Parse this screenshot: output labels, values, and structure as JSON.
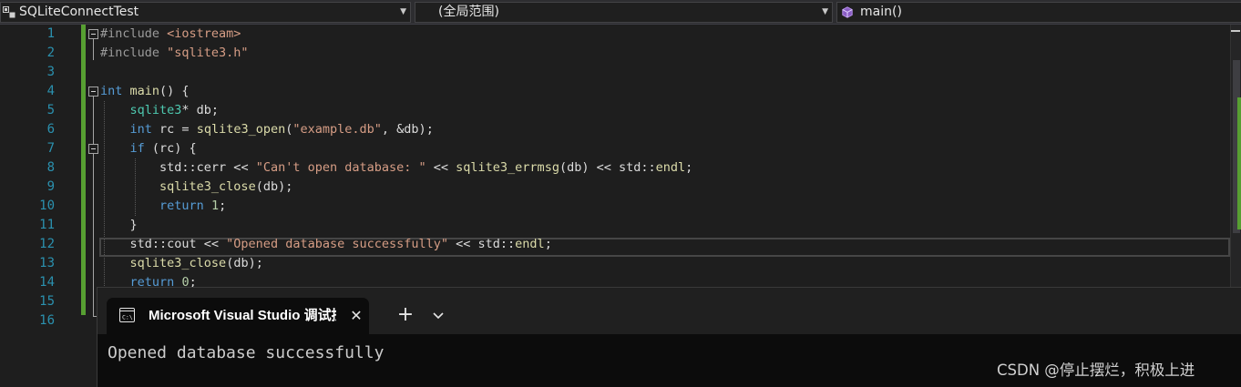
{
  "navbar": {
    "project": "SQLiteConnectTest",
    "scope": "(全局范围)",
    "member": "main()"
  },
  "editor": {
    "line_numbers": [
      "1",
      "2",
      "3",
      "4",
      "5",
      "6",
      "7",
      "8",
      "9",
      "10",
      "11",
      "12",
      "13",
      "14",
      "15",
      "16"
    ],
    "lines": [
      [
        {
          "c": "pp",
          "t": "#include "
        },
        {
          "c": "str",
          "t": "<iostream>"
        }
      ],
      [
        {
          "c": "pp",
          "t": "#include "
        },
        {
          "c": "str",
          "t": "\"sqlite3.h\""
        }
      ],
      [],
      [
        {
          "c": "kw",
          "t": "int"
        },
        {
          "c": "plain",
          "t": " "
        },
        {
          "c": "fn",
          "t": "main"
        },
        {
          "c": "plain",
          "t": "() {"
        }
      ],
      [
        {
          "c": "plain",
          "t": "    "
        },
        {
          "c": "ty",
          "t": "sqlite3"
        },
        {
          "c": "plain",
          "t": "* db;"
        }
      ],
      [
        {
          "c": "plain",
          "t": "    "
        },
        {
          "c": "kw",
          "t": "int"
        },
        {
          "c": "plain",
          "t": " rc = "
        },
        {
          "c": "fn",
          "t": "sqlite3_open"
        },
        {
          "c": "plain",
          "t": "("
        },
        {
          "c": "str",
          "t": "\"example.db\""
        },
        {
          "c": "plain",
          "t": ", &db);"
        }
      ],
      [
        {
          "c": "plain",
          "t": "    "
        },
        {
          "c": "kw",
          "t": "if"
        },
        {
          "c": "plain",
          "t": " (rc) {"
        }
      ],
      [
        {
          "c": "plain",
          "t": "        std::"
        },
        {
          "c": "plain",
          "t": "cerr << "
        },
        {
          "c": "str",
          "t": "\"Can't open database: \""
        },
        {
          "c": "plain",
          "t": " << "
        },
        {
          "c": "fn",
          "t": "sqlite3_errmsg"
        },
        {
          "c": "plain",
          "t": "(db) << std::"
        },
        {
          "c": "fn",
          "t": "endl"
        },
        {
          "c": "plain",
          "t": ";"
        }
      ],
      [
        {
          "c": "plain",
          "t": "        "
        },
        {
          "c": "fn",
          "t": "sqlite3_close"
        },
        {
          "c": "plain",
          "t": "(db);"
        }
      ],
      [
        {
          "c": "plain",
          "t": "        "
        },
        {
          "c": "kw",
          "t": "return"
        },
        {
          "c": "plain",
          "t": " "
        },
        {
          "c": "num",
          "t": "1"
        },
        {
          "c": "plain",
          "t": ";"
        }
      ],
      [
        {
          "c": "plain",
          "t": "    }"
        }
      ],
      [
        {
          "c": "plain",
          "t": "    std::cout << "
        },
        {
          "c": "str",
          "t": "\"Opened database successfully\""
        },
        {
          "c": "plain",
          "t": " << std::"
        },
        {
          "c": "fn",
          "t": "endl"
        },
        {
          "c": "plain",
          "t": ";"
        }
      ],
      [
        {
          "c": "plain",
          "t": "    "
        },
        {
          "c": "fn",
          "t": "sqlite3_close"
        },
        {
          "c": "plain",
          "t": "(db);"
        }
      ],
      [
        {
          "c": "plain",
          "t": "    "
        },
        {
          "c": "kw",
          "t": "return"
        },
        {
          "c": "plain",
          "t": " "
        },
        {
          "c": "num",
          "t": "0"
        },
        {
          "c": "plain",
          "t": ";"
        }
      ],
      [],
      []
    ]
  },
  "terminal": {
    "tab_title": "Microsoft Visual Studio 调试控制台",
    "close_glyph": "✕",
    "new_tab_glyph": "+",
    "output": "Opened database successfully"
  },
  "watermark": "CSDN @停止摆烂，积极上进",
  "colors": {
    "keyword": "#569cd6",
    "string": "#d69d85",
    "type": "#4ec9b0",
    "function": "#dcdcaa",
    "line_number": "#2b91af",
    "change_bar": "#579f32"
  },
  "icons": {
    "project": "cpp-project-icon",
    "member": "method-cube-icon",
    "terminal_tab": "console-window-icon",
    "tab_menu": "chevron-down-icon"
  }
}
